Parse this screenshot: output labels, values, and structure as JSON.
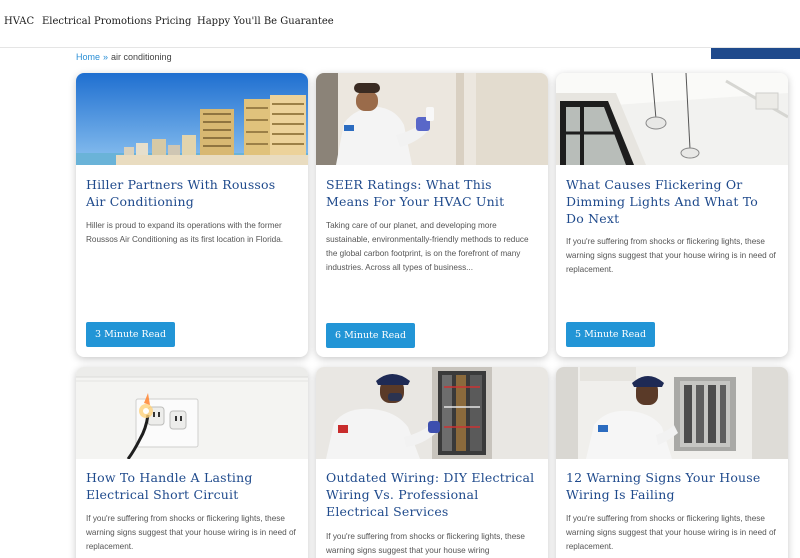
{
  "nav": {
    "items": [
      "HVAC",
      "Electrical",
      "Promotions",
      "Pricing",
      "Happy You'll Be Guarantee"
    ]
  },
  "breadcrumb": {
    "home": "Home",
    "separator": "»",
    "current": "air conditioning"
  },
  "colors": {
    "title_blue": "#1f4a8c",
    "button_blue": "#2295d6",
    "link_blue": "#2a8fd6"
  },
  "cards": [
    {
      "image": "beach-condos-image",
      "title": "Hiller Partners With Roussos Air Conditioning",
      "excerpt": "Hiller is proud to expand its operations with the former Roussos Air Conditioning as its first location in Florida.",
      "button": "3 Minute Read"
    },
    {
      "image": "technician-thermostat-image",
      "title": "SEER Ratings: What This Means For Your HVAC Unit",
      "excerpt": "Taking care of our planet, and developing more sustainable, environmentally-friendly methods to reduce the global carbon footprint, is on the forefront of many industries. Across all types of business...",
      "button": "6 Minute Read"
    },
    {
      "image": "ceiling-lights-image",
      "title": "What Causes Flickering Or Dimming Lights And What To Do Next",
      "excerpt": "If you're suffering from shocks or flickering lights, these warning signs suggest that your house wiring is in need of replacement.",
      "button": "5 Minute Read"
    },
    {
      "image": "sparking-outlet-image",
      "title": "How To Handle A Lasting Electrical Short Circuit",
      "excerpt": "If you're suffering from shocks or flickering lights, these warning signs suggest that your house wiring is in need of replacement."
    },
    {
      "image": "electrician-panel-image",
      "title": "Outdated Wiring: DIY Electrical Wiring Vs. Professional Electrical Services",
      "excerpt": "If you're suffering from shocks or flickering lights, these warning signs suggest that your house wiring"
    },
    {
      "image": "electrician-breaker-image",
      "title": "12 Warning Signs Your House Wiring Is Failing",
      "excerpt": "If you're suffering from shocks or flickering lights, these warning signs suggest that your house wiring is in need of replacement."
    }
  ]
}
